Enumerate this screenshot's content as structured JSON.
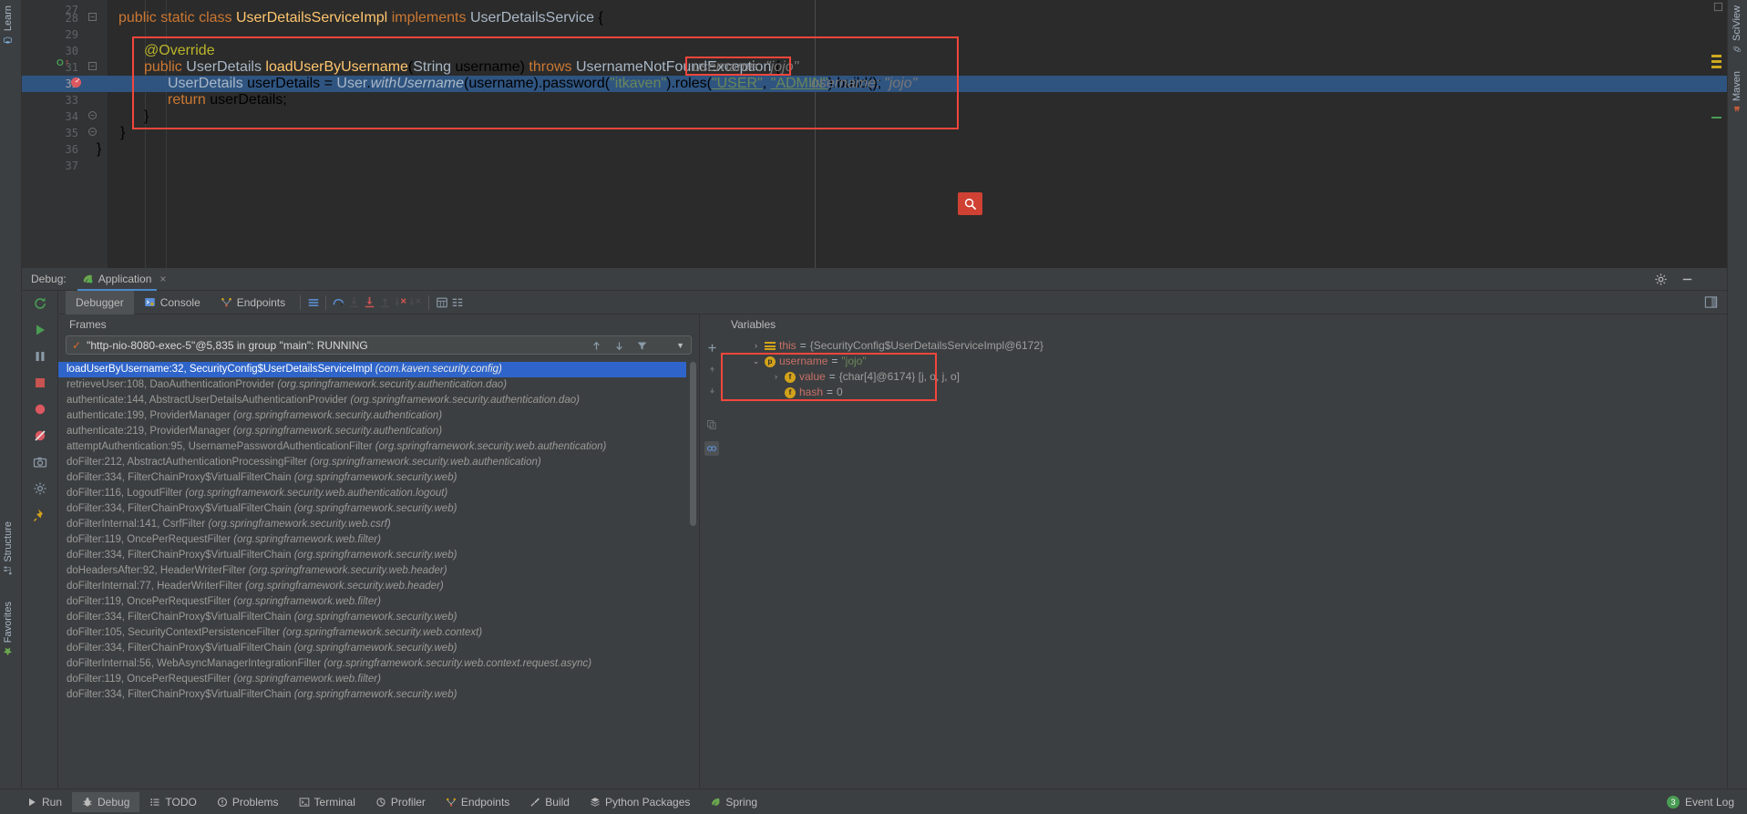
{
  "editor": {
    "lines": [
      {
        "num": "27",
        "tokens": []
      },
      {
        "num": "28",
        "tokens": [
          {
            "t": "public ",
            "c": "kw"
          },
          {
            "t": "static ",
            "c": "kw"
          },
          {
            "t": "class ",
            "c": "kw"
          },
          {
            "t": "UserDetailsServiceImpl ",
            "c": "fn"
          },
          {
            "t": "implements ",
            "c": "kw"
          },
          {
            "t": "UserDetailsService {",
            "c": "plain"
          }
        ],
        "indent": 0
      },
      {
        "num": "29",
        "tokens": []
      },
      {
        "num": "30",
        "tokens": [
          {
            "t": "@Override",
            "c": "ann"
          }
        ],
        "indent": 4
      },
      {
        "num": "31",
        "tokens": [
          {
            "t": "public ",
            "c": "kw"
          },
          {
            "t": "UserDetails ",
            "c": "plain"
          },
          {
            "t": "loadUserByUsername",
            "c": "fn"
          },
          {
            "t": "(String username) ",
            "c": "plain"
          },
          {
            "t": "throws ",
            "c": "kw"
          },
          {
            "t": "UsernameNotFoundException {",
            "c": "plain"
          }
        ],
        "indent": 4,
        "hint": "username:  \"jojo\""
      },
      {
        "num": "32",
        "tokens": [
          {
            "t": "UserDetails userDetails = User.",
            "c": "plain"
          },
          {
            "t": "withUsername",
            "c": "fni"
          },
          {
            "t": "(username).password(",
            "c": "plain"
          },
          {
            "t": "\"itkaven\"",
            "c": "str"
          },
          {
            "t": ").roles(",
            "c": "plain"
          },
          {
            "t": "\"USER\"",
            "c": "stru"
          },
          {
            "t": ", ",
            "c": "plain"
          },
          {
            "t": "\"ADMIN\"",
            "c": "stru"
          },
          {
            "t": ").build();",
            "c": "plain"
          }
        ],
        "indent": 8,
        "hint": "username:  \"jojo\"",
        "highlighted": true
      },
      {
        "num": "33",
        "tokens": [
          {
            "t": "return ",
            "c": "kw"
          },
          {
            "t": "userDetails;",
            "c": "plain"
          }
        ],
        "indent": 8
      },
      {
        "num": "34",
        "tokens": [
          {
            "t": "}",
            "c": "plain"
          }
        ],
        "indent": 4
      },
      {
        "num": "35",
        "tokens": [
          {
            "t": "}",
            "c": "plain"
          }
        ],
        "indent": 2
      },
      {
        "num": "36",
        "tokens": [
          {
            "t": "}",
            "c": "plain"
          }
        ],
        "indent": 0
      },
      {
        "num": "37",
        "tokens": []
      }
    ],
    "line31_hint": "username:  \"jojo\"",
    "line32_hint": "username:  \"jojo\"",
    "search_icon": "search-icon"
  },
  "left_strip": {
    "learn_label": "Learn",
    "structure_label": "Structure",
    "favorites_label": "Favorites"
  },
  "right_strip": {
    "sciview_label": "SciView",
    "maven_label": "Maven"
  },
  "debug": {
    "window_label": "Debug:",
    "config_name": "Application",
    "close_label": "×",
    "tabs": [
      {
        "label": "Debugger",
        "active": true,
        "icon": ""
      },
      {
        "label": "Console",
        "active": false,
        "icon": "console-icon"
      },
      {
        "label": "Endpoints",
        "active": false,
        "icon": "endpoints-icon"
      }
    ],
    "toolbar_icons": [
      "layout-icon",
      "step-over-icon",
      "step-into-icon",
      "force-step-into-icon",
      "step-out-icon",
      "drop-frame-icon",
      "run-to-cursor-icon",
      "evaluate-icon",
      "settings-table-icon"
    ],
    "rail_icons": [
      "rerun-icon",
      "resume-icon",
      "pause-icon",
      "stop-icon",
      "view-breakpoints-icon",
      "mute-breakpoints-icon",
      "camera-icon",
      "settings-icon",
      "pin-icon"
    ],
    "settings_icon": "gear-icon",
    "minimize_icon": "minimize-icon",
    "layout_icon": "layout-settings-icon"
  },
  "frames": {
    "title": "Frames",
    "thread": "\"http-nio-8080-exec-5\"@5,835 in group \"main\": RUNNING",
    "thread_status_icon": "check-icon",
    "up_icon": "arrow-up-icon",
    "down_icon": "arrow-down-icon",
    "filter_icon": "filter-icon",
    "rows": [
      {
        "method": "loadUserByUsername:32, SecurityConfig$UserDetailsServiceImpl ",
        "pkg": "(com.kaven.security.config)",
        "selected": true
      },
      {
        "method": "retrieveUser:108, DaoAuthenticationProvider ",
        "pkg": "(org.springframework.security.authentication.dao)",
        "selected": false
      },
      {
        "method": "authenticate:144, AbstractUserDetailsAuthenticationProvider ",
        "pkg": "(org.springframework.security.authentication.dao)",
        "selected": false
      },
      {
        "method": "authenticate:199, ProviderManager ",
        "pkg": "(org.springframework.security.authentication)",
        "selected": false
      },
      {
        "method": "authenticate:219, ProviderManager ",
        "pkg": "(org.springframework.security.authentication)",
        "selected": false
      },
      {
        "method": "attemptAuthentication:95, UsernamePasswordAuthenticationFilter ",
        "pkg": "(org.springframework.security.web.authentication)",
        "selected": false
      },
      {
        "method": "doFilter:212, AbstractAuthenticationProcessingFilter ",
        "pkg": "(org.springframework.security.web.authentication)",
        "selected": false
      },
      {
        "method": "doFilter:334, FilterChainProxy$VirtualFilterChain ",
        "pkg": "(org.springframework.security.web)",
        "selected": false
      },
      {
        "method": "doFilter:116, LogoutFilter ",
        "pkg": "(org.springframework.security.web.authentication.logout)",
        "selected": false
      },
      {
        "method": "doFilter:334, FilterChainProxy$VirtualFilterChain ",
        "pkg": "(org.springframework.security.web)",
        "selected": false
      },
      {
        "method": "doFilterInternal:141, CsrfFilter ",
        "pkg": "(org.springframework.security.web.csrf)",
        "selected": false
      },
      {
        "method": "doFilter:119, OncePerRequestFilter ",
        "pkg": "(org.springframework.web.filter)",
        "selected": false
      },
      {
        "method": "doFilter:334, FilterChainProxy$VirtualFilterChain ",
        "pkg": "(org.springframework.security.web)",
        "selected": false
      },
      {
        "method": "doHeadersAfter:92, HeaderWriterFilter ",
        "pkg": "(org.springframework.security.web.header)",
        "selected": false
      },
      {
        "method": "doFilterInternal:77, HeaderWriterFilter ",
        "pkg": "(org.springframework.security.web.header)",
        "selected": false
      },
      {
        "method": "doFilter:119, OncePerRequestFilter ",
        "pkg": "(org.springframework.web.filter)",
        "selected": false
      },
      {
        "method": "doFilter:334, FilterChainProxy$VirtualFilterChain ",
        "pkg": "(org.springframework.security.web)",
        "selected": false
      },
      {
        "method": "doFilter:105, SecurityContextPersistenceFilter ",
        "pkg": "(org.springframework.security.web.context)",
        "selected": false
      },
      {
        "method": "doFilter:334, FilterChainProxy$VirtualFilterChain ",
        "pkg": "(org.springframework.security.web)",
        "selected": false
      },
      {
        "method": "doFilterInternal:56, WebAsyncManagerIntegrationFilter ",
        "pkg": "(org.springframework.security.web.context.request.async)",
        "selected": false
      },
      {
        "method": "doFilter:119, OncePerRequestFilter ",
        "pkg": "(org.springframework.web.filter)",
        "selected": false
      },
      {
        "method": "doFilter:334, FilterChainProxy$VirtualFilterChain ",
        "pkg": "(org.springframework.security.web)",
        "selected": false
      }
    ]
  },
  "variables": {
    "title": "Variables",
    "add_icon": "plus-icon",
    "rail_icons": [
      "plus-icon",
      "watch-icon"
    ],
    "rows": [
      {
        "indent": 0,
        "tri": "›",
        "badge": "obj",
        "name": "this",
        "eq": " = ",
        "value": "{SecurityConfig$UserDetailsServiceImpl@6172}",
        "value_class": "vval",
        "highlighted": false
      },
      {
        "indent": 0,
        "tri": "⌄",
        "badge": "p",
        "name": "username",
        "eq": " = ",
        "value": "\"jojo\"",
        "value_class": "vstr",
        "highlighted": true
      },
      {
        "indent": 1,
        "tri": "›",
        "badge": "f",
        "name": "value",
        "eq": " = ",
        "value": "{char[4]@6174} [j, o, j, o]",
        "value_class": "vval",
        "highlighted": true
      },
      {
        "indent": 1,
        "tri": "",
        "badge": "f",
        "name": "hash",
        "eq": " = ",
        "value": "0",
        "value_class": "vval",
        "highlighted": true
      }
    ]
  },
  "statusbar": {
    "items": [
      {
        "label": "Run",
        "icon": "play-icon",
        "active": false
      },
      {
        "label": "Debug",
        "icon": "debug-bug-icon",
        "active": true
      },
      {
        "label": "TODO",
        "icon": "todo-list-icon",
        "active": false
      },
      {
        "label": "Problems",
        "icon": "problems-icon",
        "active": false
      },
      {
        "label": "Terminal",
        "icon": "terminal-icon",
        "active": false
      },
      {
        "label": "Profiler",
        "icon": "profiler-icon",
        "active": false
      },
      {
        "label": "Endpoints",
        "icon": "endpoints-icon",
        "active": false
      },
      {
        "label": "Build",
        "icon": "build-hammer-icon",
        "active": false
      },
      {
        "label": "Python Packages",
        "icon": "python-packages-icon",
        "active": false
      },
      {
        "label": "Spring",
        "icon": "spring-leaf-icon",
        "active": false
      }
    ],
    "event_log": "Event Log",
    "event_count": "3"
  },
  "colors": {
    "background": "#3c3f41",
    "editor_bg": "#2b2b2b",
    "accent_red": "#f2463c",
    "selection_blue": "#2f5480",
    "frame_selected": "#2f65ca",
    "string_green": "#6a8759",
    "keyword_orange": "#cc7832",
    "method_yellow": "#ffc66d"
  }
}
